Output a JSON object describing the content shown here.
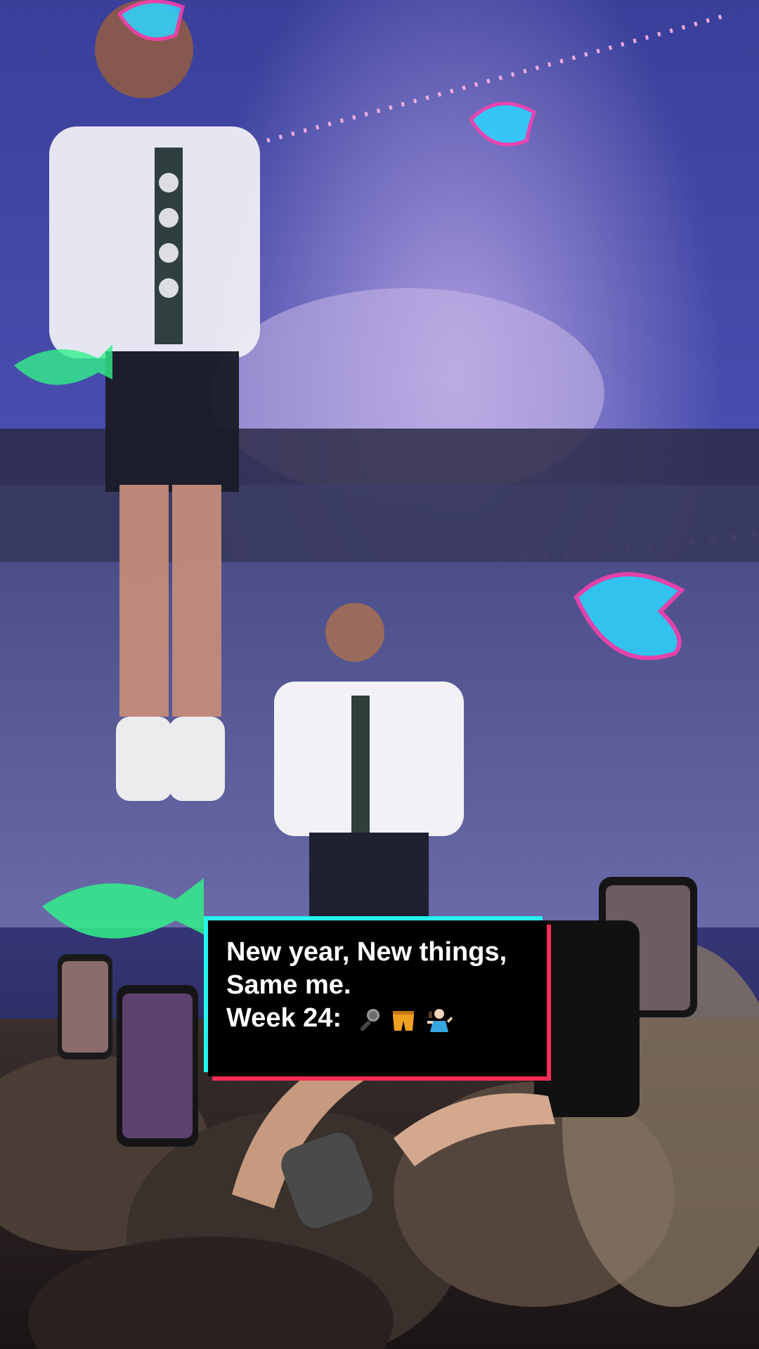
{
  "video": {
    "description_icon": "concert-video-frame"
  },
  "caption": {
    "line1": "New year, New things,",
    "line2": "Same me.",
    "line3_prefix": "Week 24:",
    "emojis": [
      "microphone-icon",
      "shorts-icon",
      "shrug-person-icon"
    ]
  },
  "colors": {
    "caption_bg": "#000000",
    "caption_text": "#ffffff",
    "accent_cyan": "#25F4EE",
    "accent_red": "#FE2C55"
  }
}
